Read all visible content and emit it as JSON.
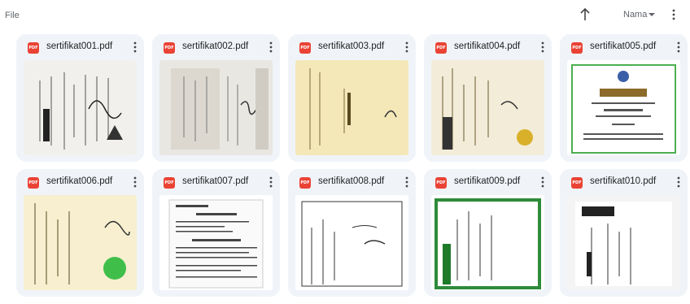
{
  "header": {
    "title": "File",
    "sort_label": "Nama",
    "sort_icon": "arrow-up-icon",
    "menu_icon": "more-vert-icon"
  },
  "files": [
    {
      "name": "sertifikat001.pdf",
      "icon": "pdf-icon",
      "icon_text": "PDF"
    },
    {
      "name": "sertifikat002.pdf",
      "icon": "pdf-icon",
      "icon_text": "PDF"
    },
    {
      "name": "sertifikat003.pdf",
      "icon": "pdf-icon",
      "icon_text": "PDF"
    },
    {
      "name": "sertifikat004.pdf",
      "icon": "pdf-icon",
      "icon_text": "PDF"
    },
    {
      "name": "sertifikat005.pdf",
      "icon": "pdf-icon",
      "icon_text": "PDF"
    },
    {
      "name": "sertifikat006.pdf",
      "icon": "pdf-icon",
      "icon_text": "PDF"
    },
    {
      "name": "sertifikat007.pdf",
      "icon": "pdf-icon",
      "icon_text": "PDF"
    },
    {
      "name": "sertifikat008.pdf",
      "icon": "pdf-icon",
      "icon_text": "PDF"
    },
    {
      "name": "sertifikat009.pdf",
      "icon": "pdf-icon",
      "icon_text": "PDF"
    },
    {
      "name": "sertifikat010.pdf",
      "icon": "pdf-icon",
      "icon_text": "PDF"
    }
  ],
  "colors": {
    "card_bg": "#f0f4f9",
    "pdf_red": "#ea4335",
    "text": "#1f1f1f",
    "muted": "#5f6368"
  }
}
